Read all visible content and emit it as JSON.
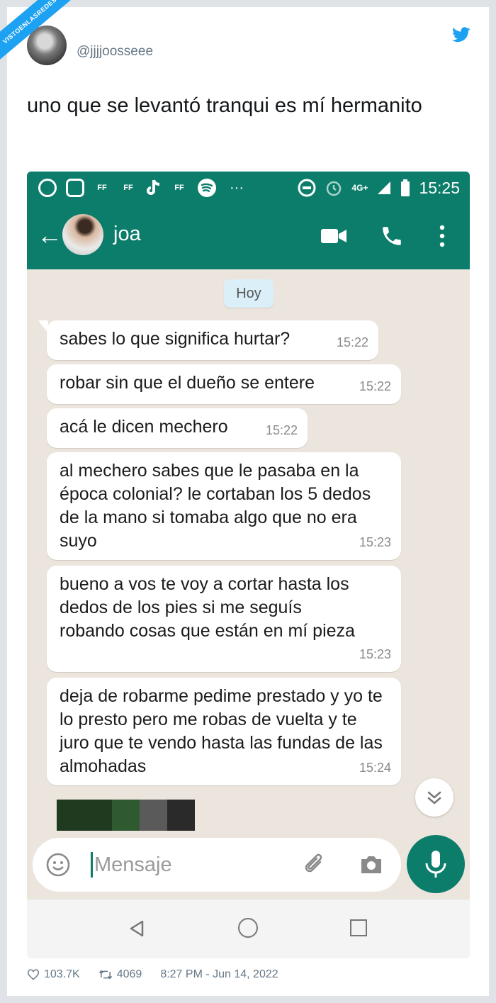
{
  "watermark": "VISTOENLASREDES",
  "tweet": {
    "handle": "@jjjjoosseee",
    "text": "uno que se levantó tranqui es mí hermanito",
    "likes": "103.7K",
    "retweets": "4069",
    "timestamp": "8:27 PM - Jun 14, 2022"
  },
  "phone": {
    "status_bar": {
      "time": "15:25",
      "network": "4G+",
      "icons": [
        "whatsapp-icon",
        "instagram-icon",
        "ff-icon",
        "ff-icon",
        "tiktok-icon",
        "ff-icon",
        "spotify-icon",
        "more-dots",
        "dnd-icon",
        "alarm-icon",
        "signal-icon",
        "battery-icon"
      ],
      "ff_label": "FF",
      "dots": "···"
    },
    "chat_header": {
      "contact_name": "joa",
      "back_glyph": "←"
    },
    "date_label": "Hoy",
    "messages": [
      {
        "text": "sabes lo que significa hurtar?",
        "time": "15:22"
      },
      {
        "text": "robar sin que el dueño se entere",
        "time": "15:22"
      },
      {
        "text": "acá le dicen mechero",
        "time": "15:22"
      },
      {
        "text": "al mechero sabes que le pasaba en la época colonial? le cortaban los 5 dedos de la mano si tomaba algo que no era suyo",
        "time": "15:23"
      },
      {
        "text": "bueno a vos te voy a cortar hasta los dedos de los pies si me seguís robando cosas que están en mí pieza",
        "time": "15:23"
      },
      {
        "text": "deja de robarme pedime prestado y yo te lo presto pero me robas de vuelta y te juro que te vendo hasta las fundas de las almohadas",
        "time": "15:24"
      }
    ],
    "input": {
      "placeholder": "Mensaje"
    }
  },
  "colors": {
    "whatsapp_green": "#0c7d6b",
    "chat_bg": "#ece5dd",
    "twitter_blue": "#1da1f2"
  }
}
